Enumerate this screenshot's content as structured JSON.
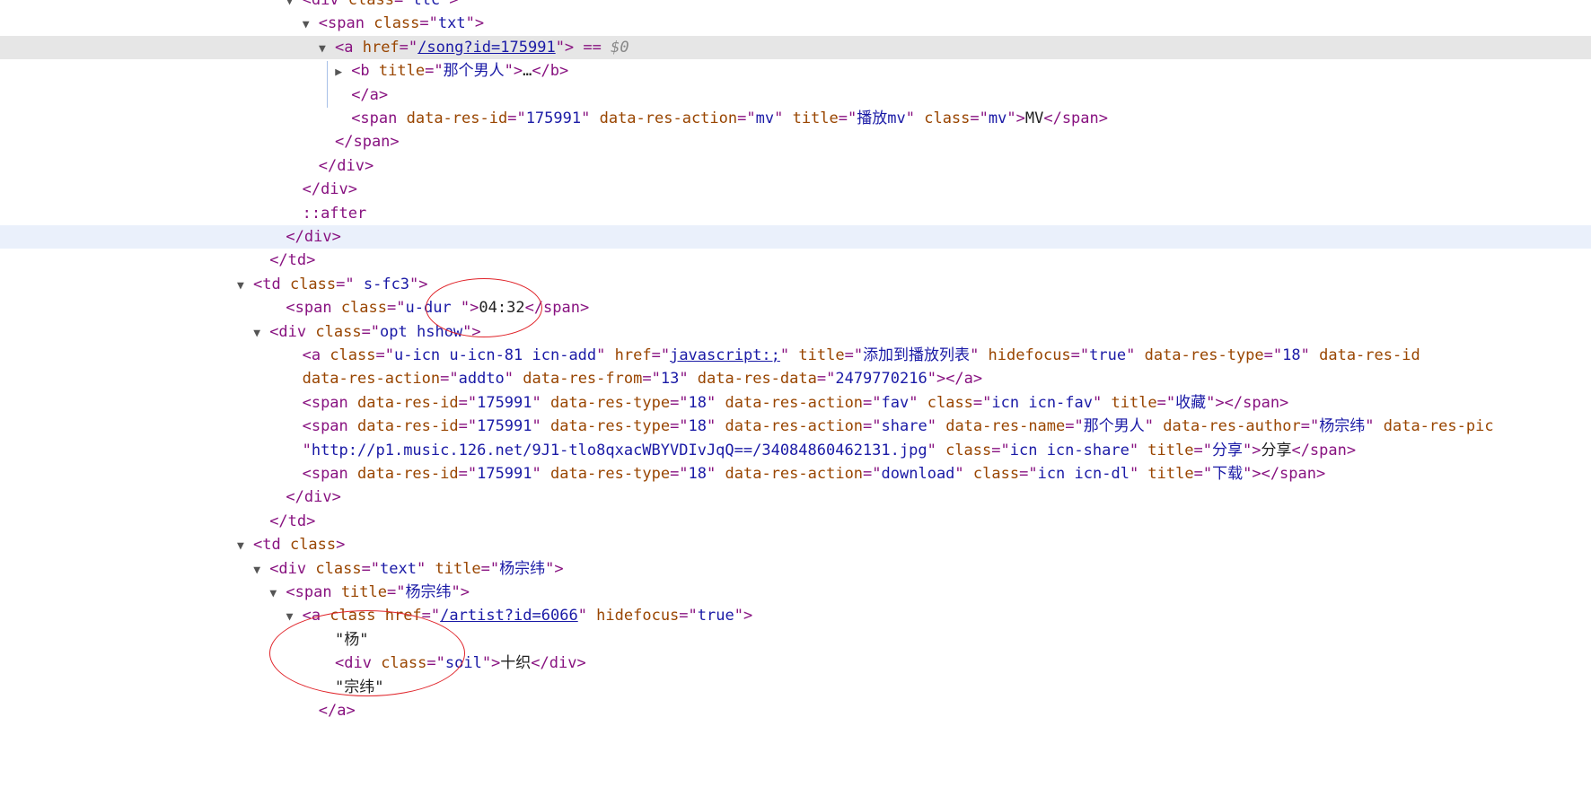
{
  "lines": [
    {
      "name": "line-div-ttc",
      "indent": 18,
      "parts": [
        {
          "t": "tri",
          "v": "▼"
        },
        {
          "t": "tag",
          "v": "<div "
        },
        {
          "t": "attr",
          "v": "class"
        },
        {
          "t": "tag",
          "v": "=\""
        },
        {
          "t": "val",
          "v": "ttc"
        },
        {
          "t": "tag",
          "v": "\">"
        }
      ]
    },
    {
      "name": "line-span-txt",
      "indent": 19,
      "parts": [
        {
          "t": "tri",
          "v": "▼"
        },
        {
          "t": "tag",
          "v": "<span "
        },
        {
          "t": "attr",
          "v": "class"
        },
        {
          "t": "tag",
          "v": "=\""
        },
        {
          "t": "val",
          "v": "txt"
        },
        {
          "t": "tag",
          "v": "\">"
        }
      ]
    },
    {
      "name": "line-a-song",
      "indent": 20,
      "state": "selected",
      "parts": [
        {
          "t": "tri",
          "v": "▼"
        },
        {
          "t": "tag",
          "v": "<a "
        },
        {
          "t": "attr",
          "v": "href"
        },
        {
          "t": "tag",
          "v": "=\""
        },
        {
          "t": "link",
          "v": "/song?id=175991"
        },
        {
          "t": "tag",
          "v": "\">"
        },
        {
          "t": "eq",
          "v": " == "
        },
        {
          "t": "dim",
          "v": "$0"
        }
      ]
    },
    {
      "name": "line-b-title",
      "indent": 21,
      "parts": [
        {
          "t": "tri",
          "v": "▶"
        },
        {
          "t": "tag",
          "v": "<b "
        },
        {
          "t": "attr",
          "v": "title"
        },
        {
          "t": "tag",
          "v": "=\""
        },
        {
          "t": "val",
          "v": "那个男人"
        },
        {
          "t": "tag",
          "v": "\">"
        },
        {
          "t": "txt",
          "v": "…"
        },
        {
          "t": "tag",
          "v": "</b>"
        }
      ]
    },
    {
      "name": "line-close-a",
      "indent": 21,
      "parts": [
        {
          "t": "tag",
          "v": "</a>"
        }
      ]
    },
    {
      "name": "line-span-mv",
      "indent": 21,
      "parts": [
        {
          "t": "tag",
          "v": "<span "
        },
        {
          "t": "attr",
          "v": "data-res-id"
        },
        {
          "t": "tag",
          "v": "=\""
        },
        {
          "t": "val",
          "v": "175991"
        },
        {
          "t": "tag",
          "v": "\" "
        },
        {
          "t": "attr",
          "v": "data-res-action"
        },
        {
          "t": "tag",
          "v": "=\""
        },
        {
          "t": "val",
          "v": "mv"
        },
        {
          "t": "tag",
          "v": "\" "
        },
        {
          "t": "attr",
          "v": "title"
        },
        {
          "t": "tag",
          "v": "=\""
        },
        {
          "t": "val",
          "v": "播放mv"
        },
        {
          "t": "tag",
          "v": "\" "
        },
        {
          "t": "attr",
          "v": "class"
        },
        {
          "t": "tag",
          "v": "=\""
        },
        {
          "t": "val",
          "v": "mv"
        },
        {
          "t": "tag",
          "v": "\">"
        },
        {
          "t": "txt",
          "v": "MV"
        },
        {
          "t": "tag",
          "v": "</span>"
        }
      ]
    },
    {
      "name": "line-close-span",
      "indent": 20,
      "parts": [
        {
          "t": "tag",
          "v": "</span>"
        }
      ]
    },
    {
      "name": "line-close-div-1",
      "indent": 19,
      "parts": [
        {
          "t": "tag",
          "v": "</div>"
        }
      ]
    },
    {
      "name": "line-close-div-2",
      "indent": 18,
      "parts": [
        {
          "t": "tag",
          "v": "</div>"
        }
      ]
    },
    {
      "name": "line-after",
      "indent": 18,
      "parts": [
        {
          "t": "pseudo",
          "v": "::after"
        }
      ]
    },
    {
      "name": "line-close-div-3",
      "indent": 17,
      "state": "hover",
      "parts": [
        {
          "t": "tag",
          "v": "</div>"
        }
      ]
    },
    {
      "name": "line-close-td-1",
      "indent": 16,
      "parts": [
        {
          "t": "tag",
          "v": "</td>"
        }
      ]
    },
    {
      "name": "line-td-sfc3",
      "indent": 15,
      "parts": [
        {
          "t": "tri",
          "v": "▼"
        },
        {
          "t": "tag",
          "v": "<td "
        },
        {
          "t": "attr",
          "v": "class"
        },
        {
          "t": "tag",
          "v": "=\""
        },
        {
          "t": "val",
          "v": " s-fc3"
        },
        {
          "t": "tag",
          "v": "\">"
        }
      ]
    },
    {
      "name": "line-span-udur",
      "indent": 17,
      "parts": [
        {
          "t": "tag",
          "v": "<span "
        },
        {
          "t": "attr",
          "v": "class"
        },
        {
          "t": "tag",
          "v": "=\""
        },
        {
          "t": "val",
          "v": "u-dur "
        },
        {
          "t": "tag",
          "v": "\">"
        },
        {
          "t": "txt",
          "v": "04:32"
        },
        {
          "t": "tag",
          "v": "</span>"
        }
      ]
    },
    {
      "name": "line-div-opt",
      "indent": 16,
      "parts": [
        {
          "t": "tri",
          "v": "▼"
        },
        {
          "t": "tag",
          "v": "<div "
        },
        {
          "t": "attr",
          "v": "class"
        },
        {
          "t": "tag",
          "v": "=\""
        },
        {
          "t": "val",
          "v": "opt hshow"
        },
        {
          "t": "tag",
          "v": "\">"
        }
      ]
    },
    {
      "name": "line-a-add",
      "indent": 18,
      "parts": [
        {
          "t": "tag",
          "v": "<a "
        },
        {
          "t": "attr",
          "v": "class"
        },
        {
          "t": "tag",
          "v": "=\""
        },
        {
          "t": "val",
          "v": "u-icn u-icn-81 icn-add"
        },
        {
          "t": "tag",
          "v": "\" "
        },
        {
          "t": "attr",
          "v": "href"
        },
        {
          "t": "tag",
          "v": "=\""
        },
        {
          "t": "link",
          "v": "javascript:;"
        },
        {
          "t": "tag",
          "v": "\" "
        },
        {
          "t": "attr",
          "v": "title"
        },
        {
          "t": "tag",
          "v": "=\""
        },
        {
          "t": "val",
          "v": "添加到播放列表"
        },
        {
          "t": "tag",
          "v": "\" "
        },
        {
          "t": "attr",
          "v": "hidefocus"
        },
        {
          "t": "tag",
          "v": "=\""
        },
        {
          "t": "val",
          "v": "true"
        },
        {
          "t": "tag",
          "v": "\" "
        },
        {
          "t": "attr",
          "v": "data-res-type"
        },
        {
          "t": "tag",
          "v": "=\""
        },
        {
          "t": "val",
          "v": "18"
        },
        {
          "t": "tag",
          "v": "\" "
        },
        {
          "t": "attr",
          "v": "data-res-id"
        }
      ]
    },
    {
      "name": "line-a-add-cont",
      "indent": 18,
      "parts": [
        {
          "t": "attr",
          "v": "data-res-action"
        },
        {
          "t": "tag",
          "v": "=\""
        },
        {
          "t": "val",
          "v": "addto"
        },
        {
          "t": "tag",
          "v": "\" "
        },
        {
          "t": "attr",
          "v": "data-res-from"
        },
        {
          "t": "tag",
          "v": "=\""
        },
        {
          "t": "val",
          "v": "13"
        },
        {
          "t": "tag",
          "v": "\" "
        },
        {
          "t": "attr",
          "v": "data-res-data"
        },
        {
          "t": "tag",
          "v": "=\""
        },
        {
          "t": "val",
          "v": "2479770216"
        },
        {
          "t": "tag",
          "v": "\">"
        },
        {
          "t": "tag",
          "v": "</a>"
        }
      ]
    },
    {
      "name": "line-span-fav",
      "indent": 18,
      "parts": [
        {
          "t": "tag",
          "v": "<span "
        },
        {
          "t": "attr",
          "v": "data-res-id"
        },
        {
          "t": "tag",
          "v": "=\""
        },
        {
          "t": "val",
          "v": "175991"
        },
        {
          "t": "tag",
          "v": "\" "
        },
        {
          "t": "attr",
          "v": "data-res-type"
        },
        {
          "t": "tag",
          "v": "=\""
        },
        {
          "t": "val",
          "v": "18"
        },
        {
          "t": "tag",
          "v": "\" "
        },
        {
          "t": "attr",
          "v": "data-res-action"
        },
        {
          "t": "tag",
          "v": "=\""
        },
        {
          "t": "val",
          "v": "fav"
        },
        {
          "t": "tag",
          "v": "\" "
        },
        {
          "t": "attr",
          "v": "class"
        },
        {
          "t": "tag",
          "v": "=\""
        },
        {
          "t": "val",
          "v": "icn icn-fav"
        },
        {
          "t": "tag",
          "v": "\" "
        },
        {
          "t": "attr",
          "v": "title"
        },
        {
          "t": "tag",
          "v": "=\""
        },
        {
          "t": "val",
          "v": "收藏"
        },
        {
          "t": "tag",
          "v": "\">"
        },
        {
          "t": "tag",
          "v": "</span>"
        }
      ]
    },
    {
      "name": "line-span-share",
      "indent": 18,
      "parts": [
        {
          "t": "tag",
          "v": "<span "
        },
        {
          "t": "attr",
          "v": "data-res-id"
        },
        {
          "t": "tag",
          "v": "=\""
        },
        {
          "t": "val",
          "v": "175991"
        },
        {
          "t": "tag",
          "v": "\" "
        },
        {
          "t": "attr",
          "v": "data-res-type"
        },
        {
          "t": "tag",
          "v": "=\""
        },
        {
          "t": "val",
          "v": "18"
        },
        {
          "t": "tag",
          "v": "\" "
        },
        {
          "t": "attr",
          "v": "data-res-action"
        },
        {
          "t": "tag",
          "v": "=\""
        },
        {
          "t": "val",
          "v": "share"
        },
        {
          "t": "tag",
          "v": "\" "
        },
        {
          "t": "attr",
          "v": "data-res-name"
        },
        {
          "t": "tag",
          "v": "=\""
        },
        {
          "t": "val",
          "v": "那个男人"
        },
        {
          "t": "tag",
          "v": "\" "
        },
        {
          "t": "attr",
          "v": "data-res-author"
        },
        {
          "t": "tag",
          "v": "=\""
        },
        {
          "t": "val",
          "v": "杨宗纬"
        },
        {
          "t": "tag",
          "v": "\" "
        },
        {
          "t": "attr",
          "v": "data-res-pic"
        }
      ]
    },
    {
      "name": "line-span-share-cont",
      "indent": 18,
      "parts": [
        {
          "t": "tag",
          "v": "\""
        },
        {
          "t": "val",
          "v": "http://p1.music.126.net/9J1-tlo8qxacWBYVDIvJqQ==/34084860462131.jpg"
        },
        {
          "t": "tag",
          "v": "\" "
        },
        {
          "t": "attr",
          "v": "class"
        },
        {
          "t": "tag",
          "v": "=\""
        },
        {
          "t": "val",
          "v": "icn icn-share"
        },
        {
          "t": "tag",
          "v": "\" "
        },
        {
          "t": "attr",
          "v": "title"
        },
        {
          "t": "tag",
          "v": "=\""
        },
        {
          "t": "val",
          "v": "分享"
        },
        {
          "t": "tag",
          "v": "\">"
        },
        {
          "t": "txt",
          "v": "分享"
        },
        {
          "t": "tag",
          "v": "</span>"
        }
      ]
    },
    {
      "name": "line-span-download",
      "indent": 18,
      "parts": [
        {
          "t": "tag",
          "v": "<span "
        },
        {
          "t": "attr",
          "v": "data-res-id"
        },
        {
          "t": "tag",
          "v": "=\""
        },
        {
          "t": "val",
          "v": "175991"
        },
        {
          "t": "tag",
          "v": "\" "
        },
        {
          "t": "attr",
          "v": "data-res-type"
        },
        {
          "t": "tag",
          "v": "=\""
        },
        {
          "t": "val",
          "v": "18"
        },
        {
          "t": "tag",
          "v": "\" "
        },
        {
          "t": "attr",
          "v": "data-res-action"
        },
        {
          "t": "tag",
          "v": "=\""
        },
        {
          "t": "val",
          "v": "download"
        },
        {
          "t": "tag",
          "v": "\" "
        },
        {
          "t": "attr",
          "v": "class"
        },
        {
          "t": "tag",
          "v": "=\""
        },
        {
          "t": "val",
          "v": "icn icn-dl"
        },
        {
          "t": "tag",
          "v": "\" "
        },
        {
          "t": "attr",
          "v": "title"
        },
        {
          "t": "tag",
          "v": "=\""
        },
        {
          "t": "val",
          "v": "下载"
        },
        {
          "t": "tag",
          "v": "\">"
        },
        {
          "t": "tag",
          "v": "</span>"
        }
      ]
    },
    {
      "name": "line-close-div-4",
      "indent": 17,
      "parts": [
        {
          "t": "tag",
          "v": "</div>"
        }
      ]
    },
    {
      "name": "line-close-td-2",
      "indent": 16,
      "parts": [
        {
          "t": "tag",
          "v": "</td>"
        }
      ]
    },
    {
      "name": "line-td-class",
      "indent": 15,
      "parts": [
        {
          "t": "tri",
          "v": "▼"
        },
        {
          "t": "tag",
          "v": "<td "
        },
        {
          "t": "attr",
          "v": "class"
        },
        {
          "t": "tag",
          "v": ">"
        }
      ]
    },
    {
      "name": "line-div-text",
      "indent": 16,
      "parts": [
        {
          "t": "tri",
          "v": "▼"
        },
        {
          "t": "tag",
          "v": "<div "
        },
        {
          "t": "attr",
          "v": "class"
        },
        {
          "t": "tag",
          "v": "=\""
        },
        {
          "t": "val",
          "v": "text"
        },
        {
          "t": "tag",
          "v": "\" "
        },
        {
          "t": "attr",
          "v": "title"
        },
        {
          "t": "tag",
          "v": "=\""
        },
        {
          "t": "val",
          "v": "杨宗纬"
        },
        {
          "t": "tag",
          "v": "\">"
        }
      ]
    },
    {
      "name": "line-span-title",
      "indent": 17,
      "parts": [
        {
          "t": "tri",
          "v": "▼"
        },
        {
          "t": "tag",
          "v": "<span "
        },
        {
          "t": "attr",
          "v": "title"
        },
        {
          "t": "tag",
          "v": "=\""
        },
        {
          "t": "val",
          "v": "杨宗纬"
        },
        {
          "t": "tag",
          "v": "\">"
        }
      ]
    },
    {
      "name": "line-a-artist",
      "indent": 18,
      "parts": [
        {
          "t": "tri",
          "v": "▼"
        },
        {
          "t": "tag",
          "v": "<a "
        },
        {
          "t": "attr",
          "v": "class href"
        },
        {
          "t": "tag",
          "v": "=\""
        },
        {
          "t": "link",
          "v": "/artist?id=6066"
        },
        {
          "t": "tag",
          "v": "\" "
        },
        {
          "t": "attr",
          "v": "hidefocus"
        },
        {
          "t": "tag",
          "v": "=\""
        },
        {
          "t": "val",
          "v": "true"
        },
        {
          "t": "tag",
          "v": "\">"
        }
      ]
    },
    {
      "name": "line-text-yang",
      "indent": 20,
      "parts": [
        {
          "t": "txt",
          "v": "\"杨\""
        }
      ]
    },
    {
      "name": "line-div-soil",
      "indent": 20,
      "parts": [
        {
          "t": "tag",
          "v": "<div "
        },
        {
          "t": "attr",
          "v": "class"
        },
        {
          "t": "tag",
          "v": "=\""
        },
        {
          "t": "val",
          "v": "soil"
        },
        {
          "t": "tag",
          "v": "\">"
        },
        {
          "t": "txt",
          "v": "十织"
        },
        {
          "t": "tag",
          "v": "</div>"
        }
      ]
    },
    {
      "name": "line-text-zongwei",
      "indent": 20,
      "parts": [
        {
          "t": "txt",
          "v": "\"宗纬\""
        }
      ]
    },
    {
      "name": "line-close-a-2",
      "indent": 19,
      "parts": [
        {
          "t": "tag",
          "v": "</a>"
        }
      ]
    }
  ]
}
